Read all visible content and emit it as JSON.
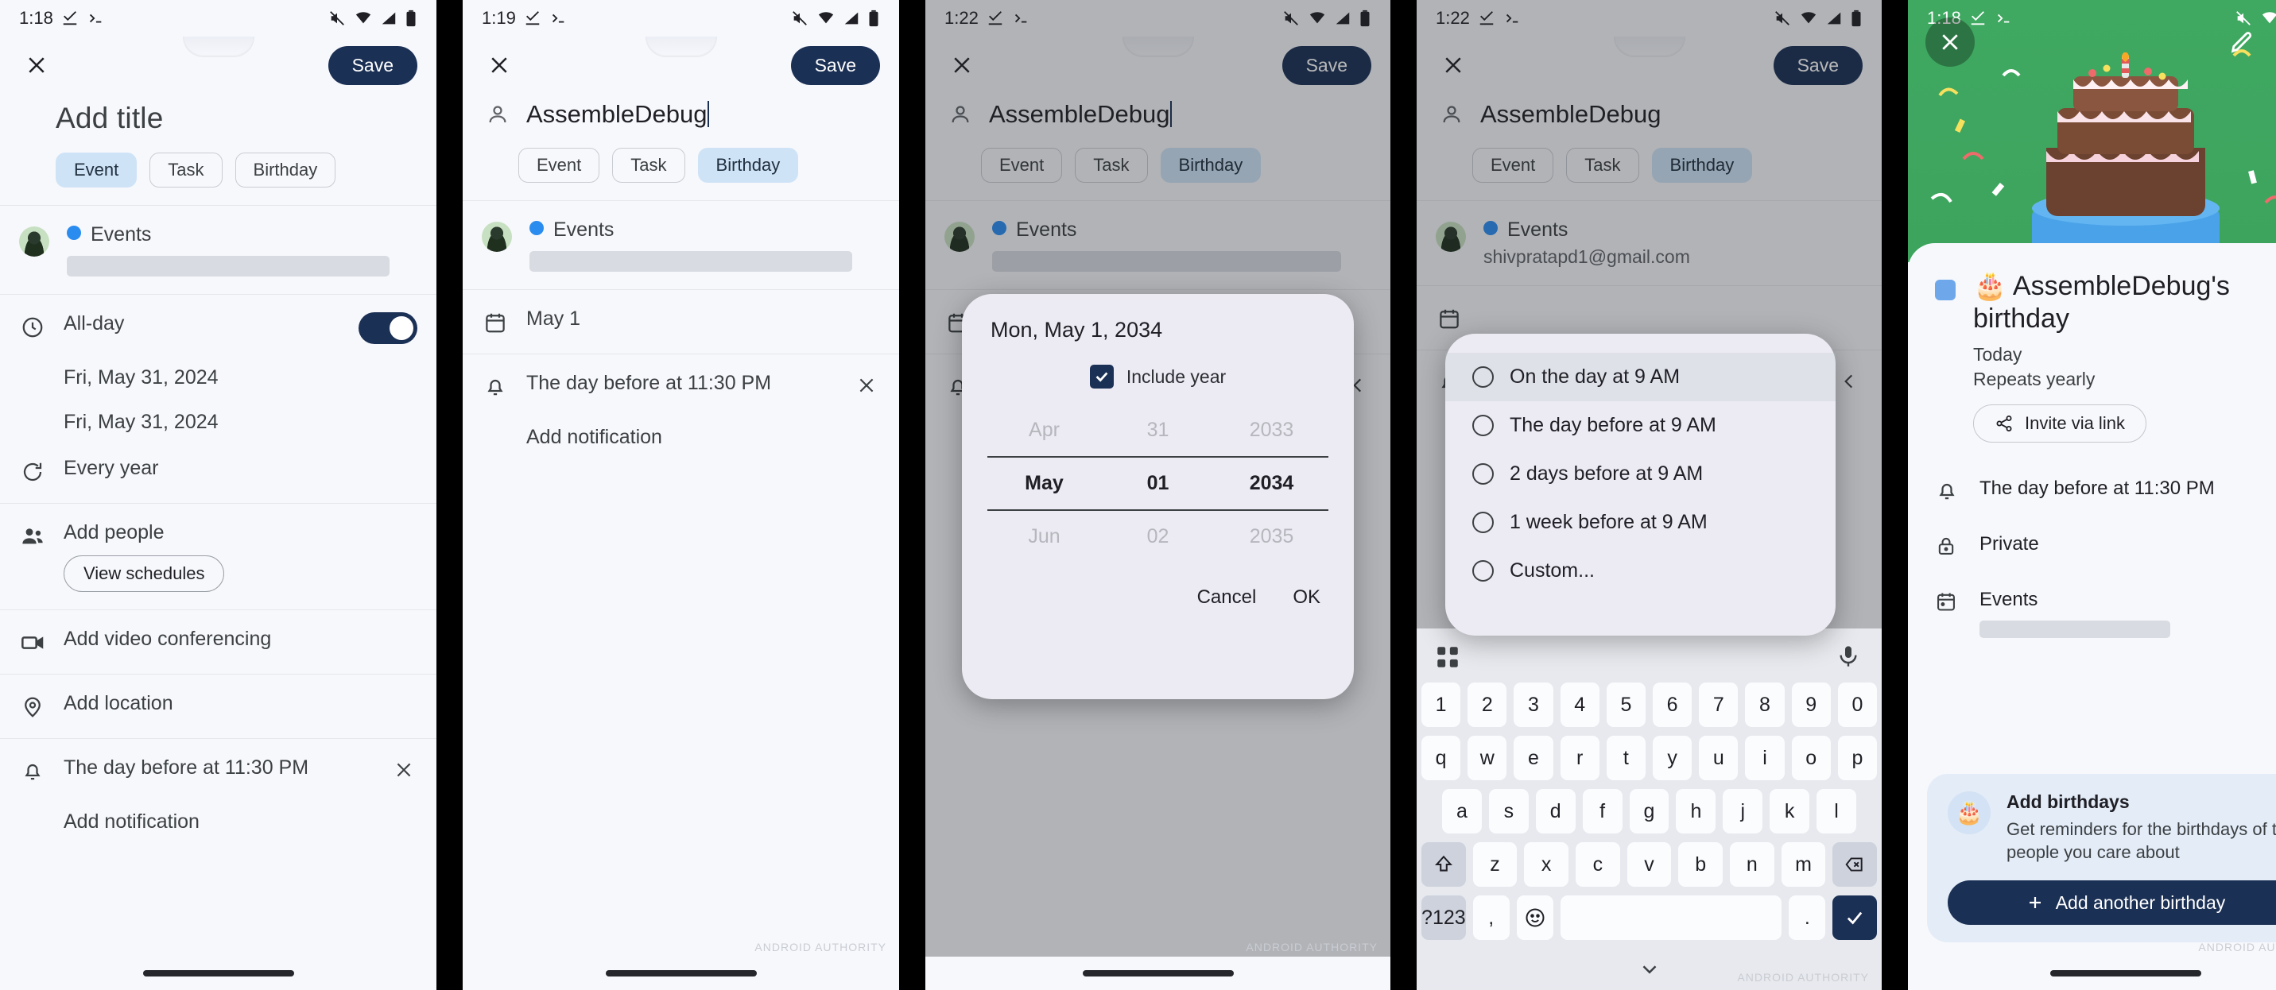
{
  "panels": [
    {
      "status": {
        "time": "1:18",
        "icons": [
          "check-download-icon",
          "terminal-icon",
          "mute-icon",
          "wifi-icon",
          "signal-icon",
          "battery-icon"
        ]
      },
      "appbar": {
        "close": "×",
        "save": "Save"
      },
      "title_placeholder": "Add title",
      "chips": [
        {
          "label": "Event",
          "selected": true
        },
        {
          "label": "Task",
          "selected": false
        },
        {
          "label": "Birthday",
          "selected": false
        }
      ],
      "calendar": {
        "name": "Events"
      },
      "allday": {
        "label": "All-day",
        "on": true
      },
      "start_date": "Fri, May 31, 2024",
      "end_date": "Fri, May 31, 2024",
      "recurrence": "Every year",
      "people": {
        "label": "Add people",
        "button": "View schedules"
      },
      "video": "Add video conferencing",
      "location": "Add location",
      "notification": "The day before at 11:30 PM",
      "add_notification": "Add notification"
    },
    {
      "status": {
        "time": "1:19"
      },
      "appbar": {
        "close": "×",
        "save": "Save"
      },
      "title_value": "AssembleDebug",
      "chips": [
        {
          "label": "Event",
          "selected": false
        },
        {
          "label": "Task",
          "selected": false
        },
        {
          "label": "Birthday",
          "selected": true
        }
      ],
      "calendar": {
        "name": "Events"
      },
      "date": "May 1",
      "notification": "The day before at 11:30 PM",
      "add_notification": "Add notification"
    },
    {
      "status": {
        "time": "1:22"
      },
      "appbar": {
        "close": "×",
        "save": "Save"
      },
      "title_value": "AssembleDebug",
      "chips": [
        {
          "label": "Event",
          "selected": false
        },
        {
          "label": "Task",
          "selected": false
        },
        {
          "label": "Birthday",
          "selected": true
        }
      ],
      "calendar": {
        "name": "Events"
      },
      "date_picker": {
        "title": "Mon, May 1, 2034",
        "include_year_label": "Include year",
        "include_year_checked": true,
        "month": {
          "prev": "Apr",
          "current": "May",
          "next": "Jun"
        },
        "day": {
          "prev": "31",
          "current": "01",
          "next": "02"
        },
        "year": {
          "prev": "2033",
          "current": "2034",
          "next": "2035"
        },
        "cancel": "Cancel",
        "ok": "OK"
      }
    },
    {
      "status": {
        "time": "1:22"
      },
      "appbar": {
        "close": "×",
        "save": "Save"
      },
      "title_value": "AssembleDebug",
      "chips": [
        {
          "label": "Event",
          "selected": false
        },
        {
          "label": "Task",
          "selected": false
        },
        {
          "label": "Birthday",
          "selected": true
        }
      ],
      "calendar": {
        "name": "Events",
        "email": "shivpratapd1@gmail.com"
      },
      "notification_options": [
        {
          "label": "On the day at 9 AM",
          "selected": false,
          "highlight": true
        },
        {
          "label": "The day before at 9 AM",
          "selected": false,
          "highlight": false
        },
        {
          "label": "2 days before at 9 AM",
          "selected": false,
          "highlight": false
        },
        {
          "label": "1 week before at 9 AM",
          "selected": false,
          "highlight": false
        },
        {
          "label": "Custom...",
          "selected": false,
          "highlight": false
        }
      ],
      "keyboard": {
        "rows": [
          [
            "1",
            "2",
            "3",
            "4",
            "5",
            "6",
            "7",
            "8",
            "9",
            "0"
          ],
          [
            "q",
            "w",
            "e",
            "r",
            "t",
            "y",
            "u",
            "i",
            "o",
            "p"
          ],
          [
            "a",
            "s",
            "d",
            "f",
            "g",
            "h",
            "j",
            "k",
            "l"
          ],
          [
            "z",
            "x",
            "c",
            "v",
            "b",
            "n",
            "m"
          ]
        ],
        "shift": "shift-icon",
        "backspace": "backspace-icon",
        "symbols": "?123",
        "comma": ",",
        "emoji": "emoji-icon",
        "space": "",
        "period": ".",
        "enter": "check-icon"
      }
    },
    {
      "status": {
        "time": "1:18"
      },
      "hero": {
        "close": "×",
        "edit": "pencil-icon",
        "more": "more-vert-icon"
      },
      "event": {
        "emoji": "🎂",
        "title": "AssembleDebug's birthday",
        "when": "Today",
        "repeat": "Repeats yearly",
        "invite": "Invite via link",
        "notification": "The day before at 11:30 PM",
        "visibility": "Private",
        "calendar": "Events"
      },
      "promo": {
        "icon": "🎂",
        "heading": "Add birthdays",
        "body": "Get reminders for the birthdays of the people you care about",
        "button": "Add another birthday"
      }
    }
  ]
}
